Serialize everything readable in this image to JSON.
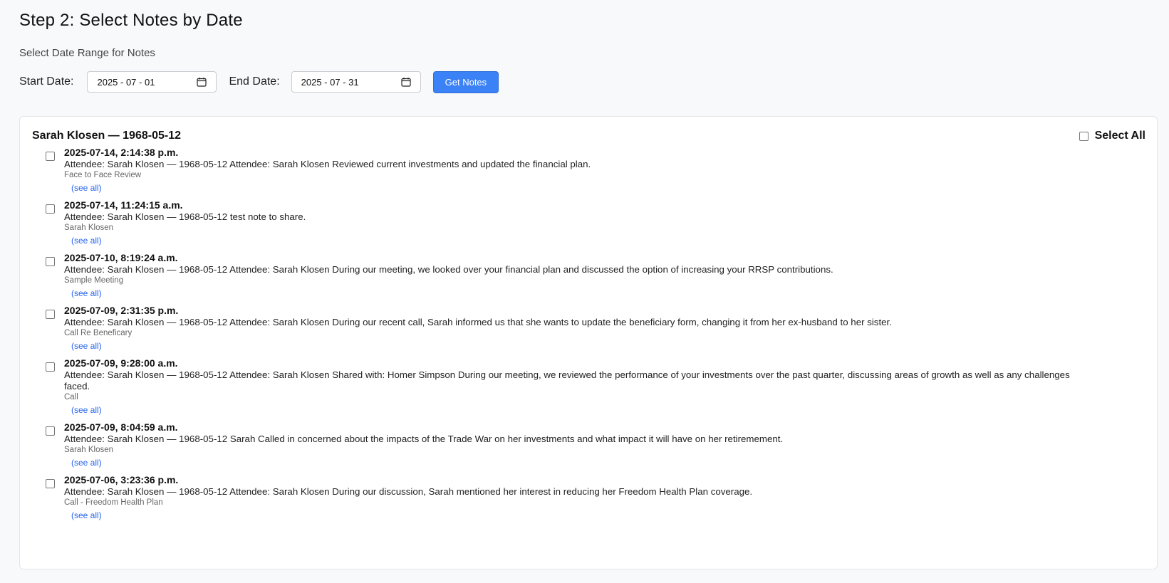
{
  "header": {
    "title": "Step 2: Select Notes by Date",
    "subtitle": "Select Date Range for Notes"
  },
  "controls": {
    "start_label": "Start Date:",
    "start_value": "2025 - 07 - 01",
    "end_label": "End Date:",
    "end_value": "2025 - 07 - 31",
    "get_notes_label": "Get Notes"
  },
  "colors": {
    "accent": "#3b82f6",
    "link": "#2563eb"
  },
  "client": {
    "name": "Sarah Klosen — 1968-05-12",
    "select_all_label": "Select All"
  },
  "notes": [
    {
      "timestamp": "2025-07-14, 2:14:38 p.m.",
      "text": "Attendee: Sarah Klosen — 1968-05-12 Attendee: Sarah Klosen Reviewed current investments and updated the financial plan.",
      "subject": "Face to Face Review",
      "see_all": "(see all)"
    },
    {
      "timestamp": "2025-07-14, 11:24:15 a.m.",
      "text": "Attendee: Sarah Klosen — 1968-05-12 test note to share.",
      "subject": "Sarah Klosen",
      "see_all": "(see all)"
    },
    {
      "timestamp": "2025-07-10, 8:19:24 a.m.",
      "text": "Attendee: Sarah Klosen — 1968-05-12 Attendee: Sarah Klosen During our meeting, we looked over your financial plan and discussed the option of increasing your RRSP contributions.",
      "subject": "Sample Meeting",
      "see_all": "(see all)"
    },
    {
      "timestamp": "2025-07-09, 2:31:35 p.m.",
      "text": "Attendee: Sarah Klosen — 1968-05-12 Attendee: Sarah Klosen During our recent call, Sarah informed us that she wants to update the beneficiary form, changing it from her ex-husband to her sister.",
      "subject": "Call Re Beneficary",
      "see_all": "(see all)"
    },
    {
      "timestamp": "2025-07-09, 9:28:00 a.m.",
      "text": "Attendee: Sarah Klosen — 1968-05-12 Attendee: Sarah Klosen Shared with: Homer Simpson During our meeting, we reviewed the performance of your investments over the past quarter, discussing areas of growth as well as any challenges faced.",
      "subject": "Call",
      "see_all": "(see all)"
    },
    {
      "timestamp": "2025-07-09, 8:04:59 a.m.",
      "text": "Attendee: Sarah Klosen — 1968-05-12 Sarah Called in concerned about the impacts of the Trade War on her investments and what impact it will have on her retiremement.",
      "subject": "Sarah Klosen",
      "see_all": "(see all)"
    },
    {
      "timestamp": "2025-07-06, 3:23:36 p.m.",
      "text": "Attendee: Sarah Klosen — 1968-05-12 Attendee: Sarah Klosen During our discussion, Sarah mentioned her interest in reducing her Freedom Health Plan coverage.",
      "subject": "Call - Freedom Health Plan",
      "see_all": "(see all)"
    }
  ]
}
